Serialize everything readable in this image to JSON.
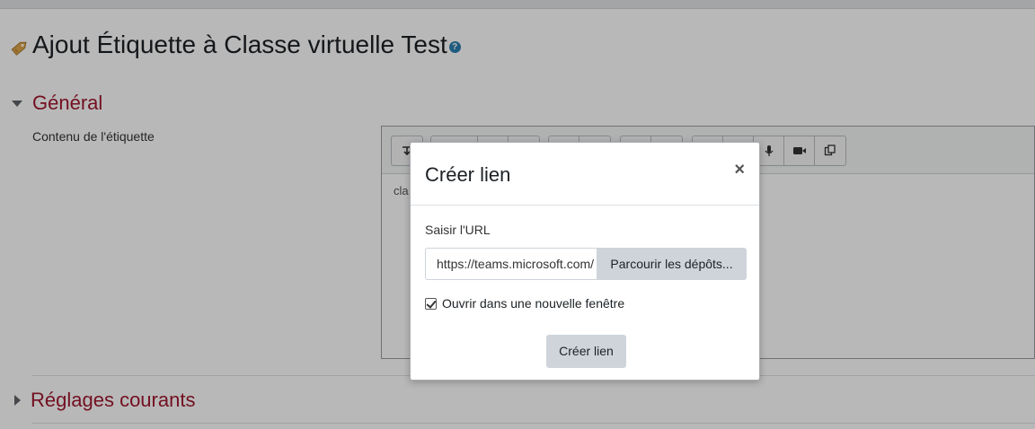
{
  "page": {
    "title": "Ajout Étiquette à Classe virtuelle Test",
    "help_glyph": "?"
  },
  "sections": {
    "general": {
      "label": "Général"
    },
    "common": {
      "label": "Réglages courants"
    }
  },
  "form": {
    "content_label": "Contenu de l'étiquette",
    "editor_content": "cla"
  },
  "modal": {
    "title": "Créer lien",
    "close_glyph": "×",
    "url_label": "Saisir l'URL",
    "url_value": "https://teams.microsoft.com/",
    "browse_label": "Parcourir les dépôts...",
    "new_window_label": "Ouvrir dans une nouvelle fenêtre",
    "new_window_checked": true,
    "create_label": "Créer lien"
  },
  "colors": {
    "section_heading": "#a0172f",
    "help_icon": "#2a7fb0",
    "tag_icon": "#e0a64a"
  }
}
